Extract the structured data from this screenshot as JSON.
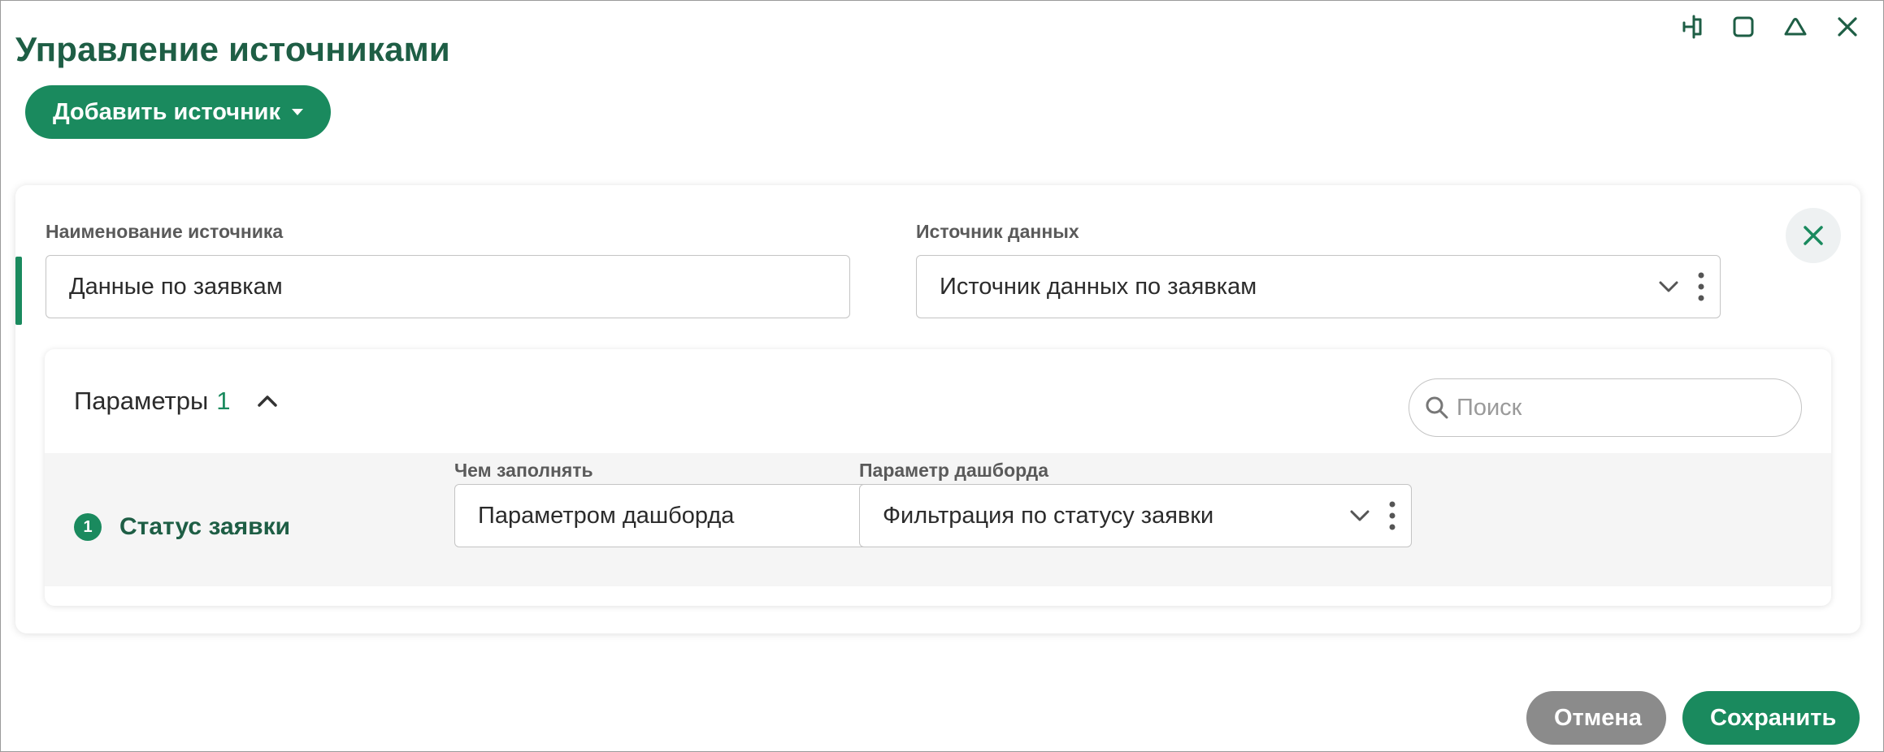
{
  "window": {
    "title": "Управление источниками",
    "controls": [
      "pin-icon",
      "maximize-icon",
      "collapse-icon",
      "close-icon"
    ]
  },
  "toolbar": {
    "add_source_label": "Добавить источник"
  },
  "source_card": {
    "name_label": "Наименование источника",
    "name_value": "Данные по заявкам",
    "data_source_label": "Источник данных",
    "data_source_value": "Источник данных по заявкам"
  },
  "parameters": {
    "title": "Параметры",
    "count": "1",
    "search_placeholder": "Поиск",
    "fill_with_label": "Чем заполнять",
    "dashboard_param_label": "Параметр дашборда",
    "rows": [
      {
        "index": "1",
        "name": "Статус заявки",
        "fill_with": "Параметром дашборда",
        "dashboard_param": "Фильтрация по статусу заявки"
      }
    ]
  },
  "footer": {
    "cancel_label": "Отмена",
    "save_label": "Сохранить"
  },
  "colors": {
    "accent": "#1a8a5e",
    "title": "#1e5e45",
    "cancel": "#8b8b8b"
  }
}
